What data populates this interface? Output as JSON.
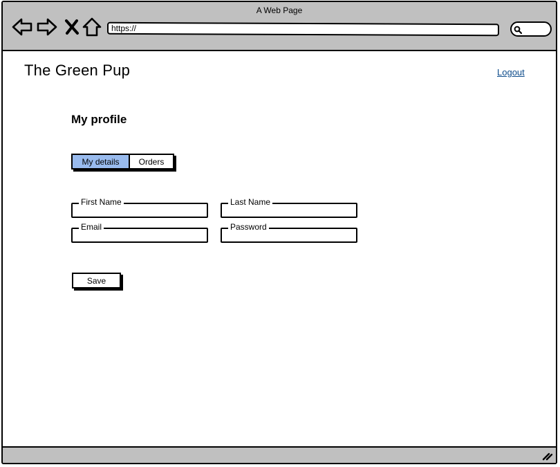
{
  "window": {
    "title": "A Web Page"
  },
  "browser": {
    "address": "https://",
    "icons": {
      "back": "back-arrow-icon",
      "forward": "forward-arrow-icon",
      "stop": "close-icon",
      "home": "home-icon",
      "search": "search-icon",
      "resize": "resize-grip-icon"
    }
  },
  "header": {
    "site_title": "The Green Pup",
    "logout_label": "Logout"
  },
  "profile": {
    "heading": "My profile",
    "tabs": [
      {
        "label": "My details",
        "active": true
      },
      {
        "label": "Orders",
        "active": false
      }
    ],
    "fields": {
      "first_name": {
        "label": "First Name",
        "value": ""
      },
      "last_name": {
        "label": "Last Name",
        "value": ""
      },
      "email": {
        "label": "Email",
        "value": ""
      },
      "password": {
        "label": "Password",
        "value": ""
      }
    },
    "save_label": "Save"
  },
  "colors": {
    "chrome": "#c0c0c0",
    "active_tab": "#99bbee",
    "link": "#0b4a8a"
  }
}
